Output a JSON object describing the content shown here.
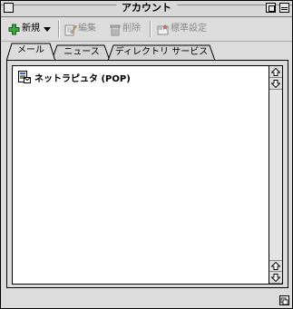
{
  "window": {
    "title": "アカウント"
  },
  "toolbar": {
    "new_label": "新規",
    "edit_label": "編集",
    "delete_label": "削除",
    "default_label": "標準設定"
  },
  "tabs": [
    {
      "label": "メール",
      "active": true
    },
    {
      "label": "ニュース",
      "active": false
    },
    {
      "label": "ディレクトリ サービス",
      "active": false
    }
  ],
  "accounts": [
    {
      "name": "ネットラピュタ (POP)",
      "icon": "mail-account-icon"
    }
  ],
  "colors": {
    "window_bg": "#dcdcdc",
    "plus_green": "#2a8a2a",
    "disabled_text": "#8a8a8a"
  }
}
